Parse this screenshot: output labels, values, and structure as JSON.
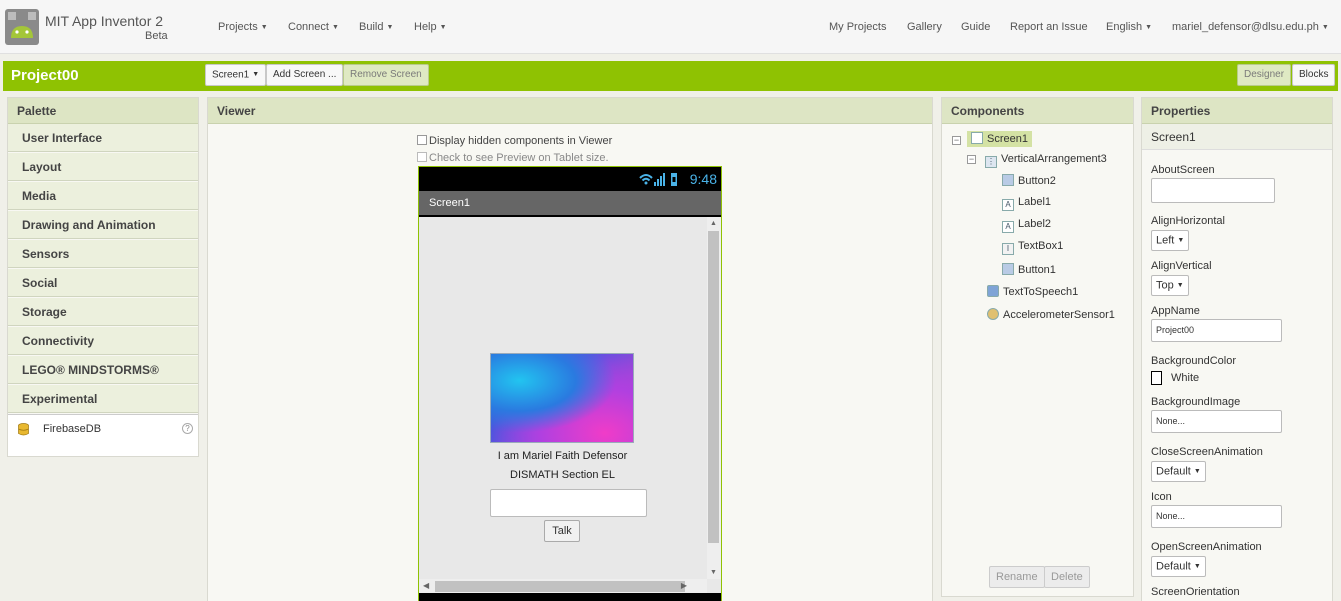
{
  "header": {
    "app_title": "MIT App Inventor 2",
    "app_beta": "Beta",
    "menus": [
      "Projects",
      "Connect",
      "Build",
      "Help"
    ],
    "links": [
      "My Projects",
      "Gallery",
      "Guide",
      "Report an Issue"
    ],
    "language": "English",
    "user": "mariel_defensor@dlsu.edu.ph"
  },
  "toolbar": {
    "project_name": "Project00",
    "screen_select": "Screen1",
    "add_screen": "Add Screen ...",
    "remove_screen": "Remove Screen",
    "designer": "Designer",
    "blocks": "Blocks"
  },
  "palette": {
    "title": "Palette",
    "categories": [
      "User Interface",
      "Layout",
      "Media",
      "Drawing and Animation",
      "Sensors",
      "Social",
      "Storage",
      "Connectivity",
      "LEGO® MINDSTORMS®",
      "Experimental"
    ],
    "experimental_items": [
      "FirebaseDB"
    ],
    "help_glyph": "?"
  },
  "viewer": {
    "title": "Viewer",
    "check_hidden": "Display hidden components in Viewer",
    "check_tablet": "Check to see Preview on Tablet size.",
    "phone": {
      "time": "9:48",
      "screen_title": "Screen1",
      "label1": "I am Mariel Faith Defensor",
      "label2": "DISMATH Section EL",
      "textbox_value": "",
      "talk_button": "Talk"
    }
  },
  "components": {
    "title": "Components",
    "tree": [
      "Screen1",
      "VerticalArrangement3",
      "Button2",
      "Label1",
      "Label2",
      "TextBox1",
      "Button1",
      "TextToSpeech1",
      "AccelerometerSensor1"
    ],
    "rename": "Rename",
    "delete": "Delete"
  },
  "properties": {
    "title": "Properties",
    "selected": "Screen1",
    "about_screen_label": "AboutScreen",
    "align_horizontal_label": "AlignHorizontal",
    "align_horizontal_value": "Left",
    "align_vertical_label": "AlignVertical",
    "align_vertical_value": "Top",
    "app_name_label": "AppName",
    "app_name_value": "Project00",
    "background_color_label": "BackgroundColor",
    "background_color_value": "White",
    "background_image_label": "BackgroundImage",
    "background_image_value": "None...",
    "close_anim_label": "CloseScreenAnimation",
    "close_anim_value": "Default",
    "icon_label": "Icon",
    "icon_value": "None...",
    "open_anim_label": "OpenScreenAnimation",
    "open_anim_value": "Default",
    "orientation_label": "ScreenOrientation"
  },
  "colors": {
    "brand_green": "#8fc202",
    "panel_header": "#dde5c4",
    "status_time": "#4ab3e8"
  }
}
